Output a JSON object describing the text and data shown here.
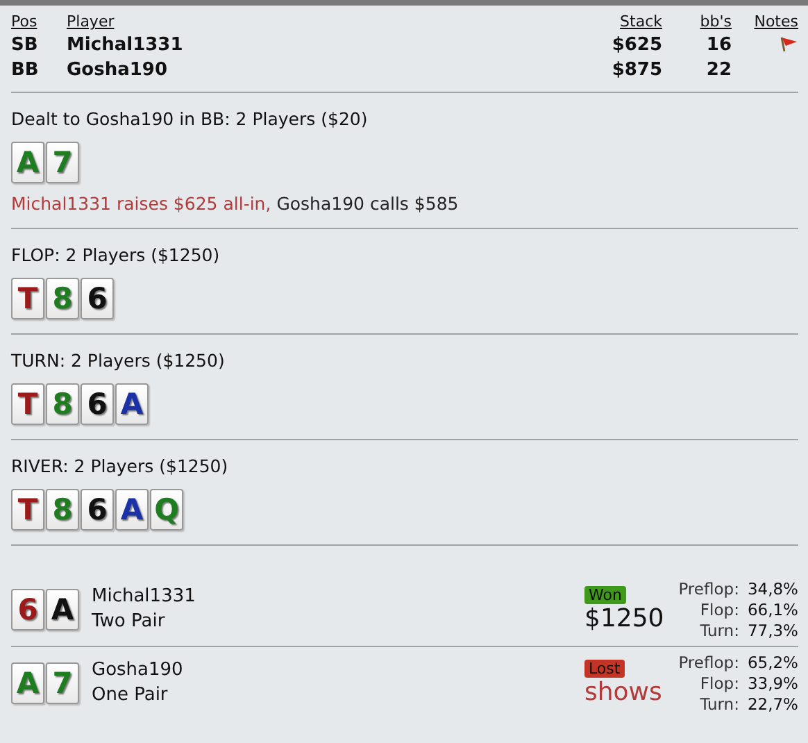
{
  "players_table": {
    "columns": [
      {
        "label": "Pos"
      },
      {
        "label": "Player"
      },
      {
        "label": "Stack"
      },
      {
        "label": "bb's"
      },
      {
        "label": "Notes"
      }
    ],
    "rows": [
      {
        "pos": "SB",
        "player": "Michal1331",
        "stack": "$625",
        "bbs": "16",
        "has_note": true
      },
      {
        "pos": "BB",
        "player": "Gosha190",
        "stack": "$875",
        "bbs": "22",
        "has_note": false
      }
    ]
  },
  "streets": [
    {
      "title": "Dealt to Gosha190 in BB: 2 Players ($20)",
      "cards": [
        {
          "rank": "A",
          "color": "#1e7d1e"
        },
        {
          "rank": "7",
          "color": "#1e7d1e"
        }
      ],
      "actions": [
        {
          "text": "Michal1331 raises $625 all-in,",
          "kind": "aggressive"
        },
        {
          "text": "Gosha190 calls $585",
          "kind": "passive"
        }
      ]
    },
    {
      "title": "FLOP: 2 Players ($1250)",
      "cards": [
        {
          "rank": "T",
          "color": "#9c1a1a"
        },
        {
          "rank": "8",
          "color": "#1e7d1e"
        },
        {
          "rank": "6",
          "color": "#111111"
        }
      ]
    },
    {
      "title": "TURN: 2 Players ($1250)",
      "cards": [
        {
          "rank": "T",
          "color": "#9c1a1a"
        },
        {
          "rank": "8",
          "color": "#1e7d1e"
        },
        {
          "rank": "6",
          "color": "#111111"
        },
        {
          "rank": "A",
          "color": "#1a31a8"
        }
      ]
    },
    {
      "title": "RIVER: 2 Players ($1250)",
      "cards": [
        {
          "rank": "T",
          "color": "#9c1a1a"
        },
        {
          "rank": "8",
          "color": "#1e7d1e"
        },
        {
          "rank": "6",
          "color": "#111111"
        },
        {
          "rank": "A",
          "color": "#1a31a8"
        },
        {
          "rank": "Q",
          "color": "#1e7d1e"
        }
      ]
    }
  ],
  "showdown": [
    {
      "cards": [
        {
          "rank": "6",
          "color": "#9c1a1a"
        },
        {
          "rank": "A",
          "color": "#111111"
        }
      ],
      "player": "Michal1331",
      "hand": "Two Pair",
      "result": {
        "kind": "won",
        "label": "Won",
        "amount": "$1250"
      },
      "equity": [
        {
          "label": "Preflop:",
          "value": "34,8%"
        },
        {
          "label": "Flop:",
          "value": "66,1%"
        },
        {
          "label": "Turn:",
          "value": "77,3%"
        }
      ]
    },
    {
      "cards": [
        {
          "rank": "A",
          "color": "#1e7d1e"
        },
        {
          "rank": "7",
          "color": "#1e7d1e"
        }
      ],
      "player": "Gosha190",
      "hand": "One Pair",
      "result": {
        "kind": "lost",
        "label": "Lost",
        "amount": "shows"
      },
      "equity": [
        {
          "label": "Preflop:",
          "value": "65,2%"
        },
        {
          "label": "Flop:",
          "value": "33,9%"
        },
        {
          "label": "Turn:",
          "value": "22,7%"
        }
      ]
    }
  ]
}
